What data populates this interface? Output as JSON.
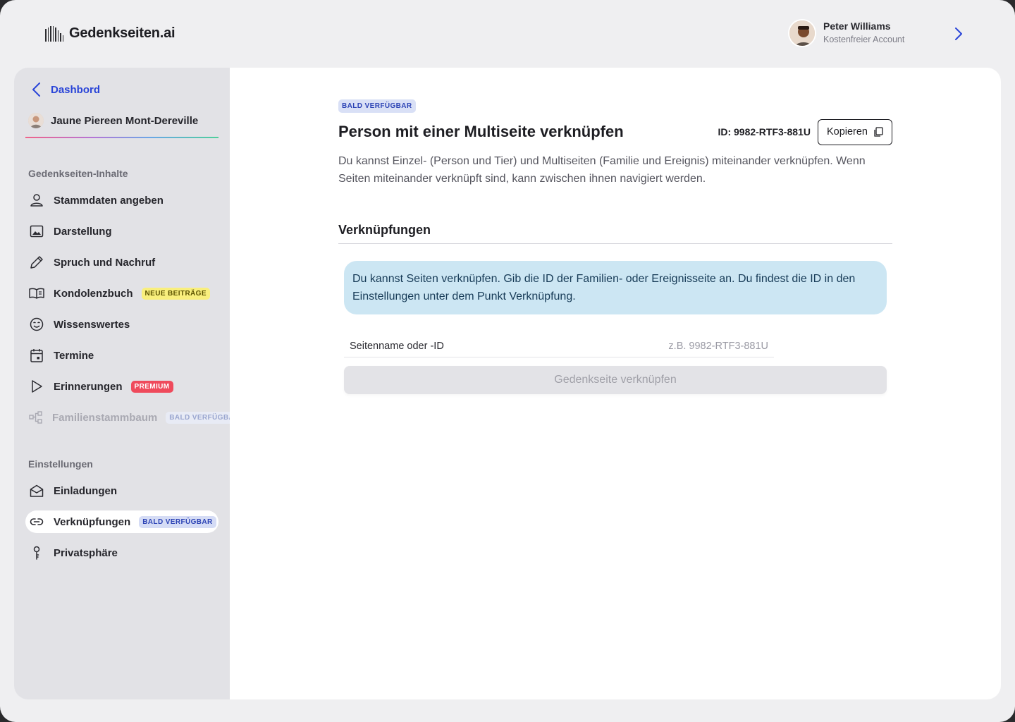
{
  "app": {
    "name": "Gedenkseiten.ai"
  },
  "user": {
    "name": "Peter Williams",
    "plan": "Kostenfreier Account"
  },
  "sidebar": {
    "back_label": "Dashbord",
    "page_owner": "Jaune Piereen Mont-Dereville",
    "content_section": {
      "title": "Gedenkseiten-Inhalte",
      "items": [
        {
          "label": "Stammdaten angeben",
          "icon": "person-icon"
        },
        {
          "label": "Darstellung",
          "icon": "image-icon"
        },
        {
          "label": "Spruch und Nachruf",
          "icon": "pencil-icon"
        },
        {
          "label": "Kondolenzbuch",
          "icon": "book-icon",
          "badge": "NEUE BEITRÄGE"
        },
        {
          "label": "Wissenswertes",
          "icon": "smiley-icon"
        },
        {
          "label": "Termine",
          "icon": "calendar-icon"
        },
        {
          "label": "Erinnerungen",
          "icon": "play-icon",
          "badge": "PREMIUM"
        },
        {
          "label": "Familienstammbaum",
          "icon": "tree-icon",
          "badge": "BALD VERFÜGBAR",
          "disabled": true
        }
      ]
    },
    "settings_section": {
      "title": "Einstellungen",
      "items": [
        {
          "label": "Einladungen",
          "icon": "envelope-icon"
        },
        {
          "label": "Verknüpfungen",
          "icon": "link-icon",
          "badge": "BALD VERFÜGBAR",
          "active": true
        },
        {
          "label": "Privatsphäre",
          "icon": "key-icon"
        }
      ]
    }
  },
  "main": {
    "badge": "BALD VERFÜGBAR",
    "title": "Person mit einer Multiseite verknüpfen",
    "id_text": "ID: 9982-RTF3-881U",
    "copy_label": "Kopieren",
    "description": "Du kannst Einzel- (Person und Tier) und Multiseiten (Familie und Ereignis) miteinander verknüpfen. Wenn Seiten miteinander verknüpft sind, kann zwischen ihnen navigiert werden.",
    "section_title": "Verknüpfungen",
    "info_text": "Du kannst Seiten verknüpfen. Gib die ID der Familien- oder Ereignisseite an. Du findest die ID in den Einstellungen unter dem Punkt Verknüpfung.",
    "field_label": "Seitenname oder -ID",
    "field_value": "",
    "field_placeholder": "z.B. 9982-RTF3-881U",
    "submit_label": "Gedenkseite verknüpfen"
  },
  "colors": {
    "accent": "#2a45d8",
    "info_bg": "#cce6f3",
    "premium": "#ef4a5c",
    "new_badge": "#f9ef7d"
  }
}
